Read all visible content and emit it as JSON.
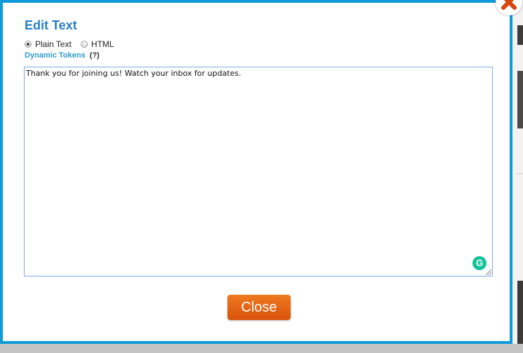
{
  "dialog": {
    "title": "Edit Text",
    "format_options": [
      {
        "label": "Plain Text",
        "selected": true
      },
      {
        "label": "HTML",
        "selected": false
      }
    ],
    "tokens_link": "Dynamic Tokens",
    "tokens_help": "(?)",
    "editor_text": "Thank you for joining us! Watch your inbox for updates.",
    "close_label": "Close",
    "close_icon": "close-x-icon",
    "grammarly_icon": "grammarly-icon",
    "grammarly_letter": "G"
  },
  "colors": {
    "accent": "#0e9ad8",
    "title": "#2a7fc0",
    "link": "#2d9ad0",
    "close_button": "#e0620f",
    "close_x": "#d9470f",
    "grammarly": "#15c39a"
  }
}
